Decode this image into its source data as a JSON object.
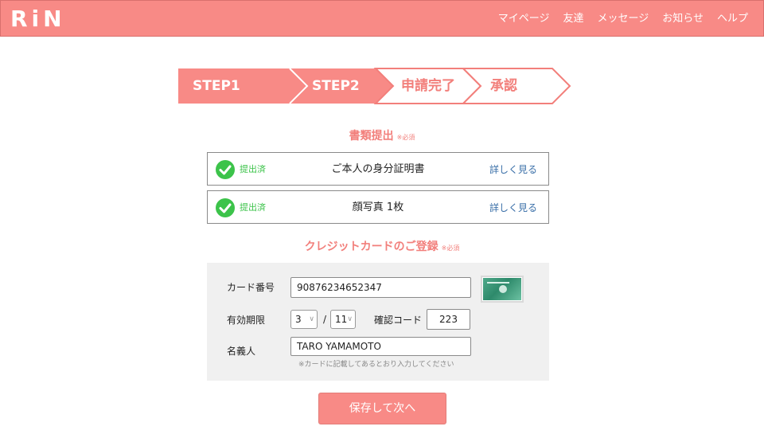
{
  "app": {
    "logo": "RiN"
  },
  "nav": {
    "items": [
      "マイページ",
      "友達",
      "メッセージ",
      "お知らせ",
      "ヘルプ"
    ]
  },
  "steps": {
    "items": [
      {
        "label": "STEP1",
        "active": true
      },
      {
        "label": "STEP2",
        "active": true
      },
      {
        "label": "申請完了",
        "active": false
      },
      {
        "label": "承認",
        "active": false
      }
    ]
  },
  "documents": {
    "title": "書類提出",
    "required_note": "※必須",
    "items": [
      {
        "status": "提出済",
        "name": "ご本人の身分証明書",
        "link": "詳しく見る"
      },
      {
        "status": "提出済",
        "name": "顔写真 1枚",
        "link": "詳しく見る"
      }
    ]
  },
  "credit_card": {
    "title": "クレジットカードのご登録",
    "required_note": "※必須",
    "number_label": "カード番号",
    "number_value": "90876234652347",
    "expiry_label": "有効期限",
    "expiry_month": "3",
    "expiry_separator": "/",
    "expiry_year": "11",
    "cvv_label": "確認コード",
    "cvv_value": "223",
    "name_label": "名義人",
    "name_value": "TARO YAMAMOTO",
    "name_hint": "※カードに記載してあるとおり入力してください"
  },
  "actions": {
    "submit_label": "保存して次へ"
  },
  "colors": {
    "accent": "#f88a86",
    "text_accent": "#f27f7b",
    "check_green": "#3cc34a",
    "link_blue": "#3a6fa8"
  }
}
